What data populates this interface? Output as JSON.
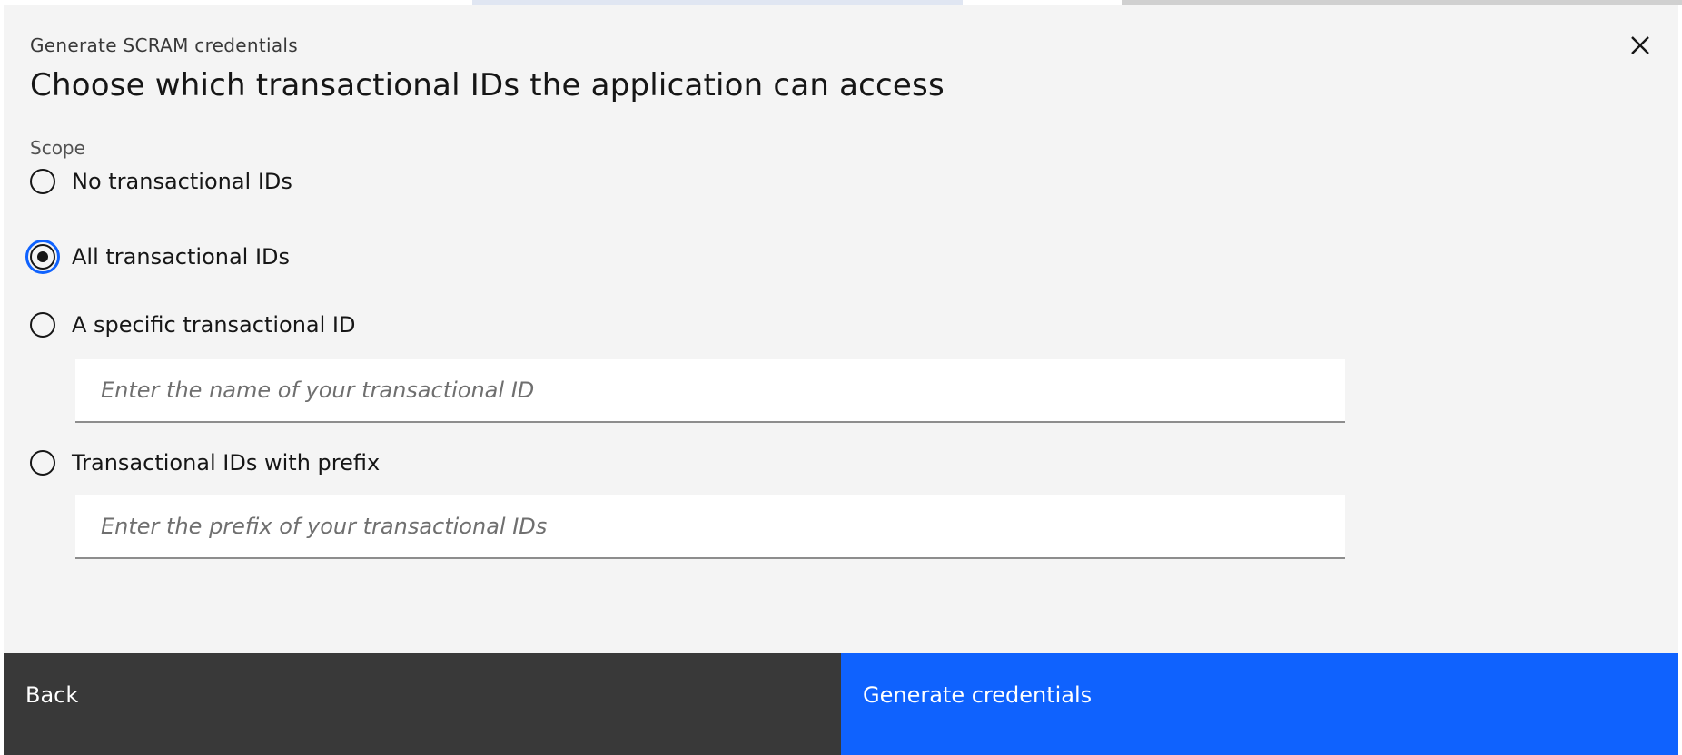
{
  "modal": {
    "label": "Generate SCRAM credentials",
    "title": "Choose which transactional IDs the application can access"
  },
  "scope": {
    "label": "Scope",
    "options": [
      {
        "label": "No transactional IDs",
        "checked": false
      },
      {
        "label": "All transactional IDs",
        "checked": true
      },
      {
        "label": "A specific transactional ID",
        "checked": false
      },
      {
        "label": "Transactional IDs with prefix",
        "checked": false
      }
    ],
    "specific_placeholder": "Enter the name of your transactional ID",
    "prefix_placeholder": "Enter the prefix of your transactional IDs"
  },
  "footer": {
    "back_label": "Back",
    "primary_label": "Generate credentials"
  },
  "colors": {
    "primary": "#0f62fe",
    "secondary": "#393939",
    "modal_bg": "#f4f4f4"
  },
  "icons": {
    "close": "close-icon"
  }
}
